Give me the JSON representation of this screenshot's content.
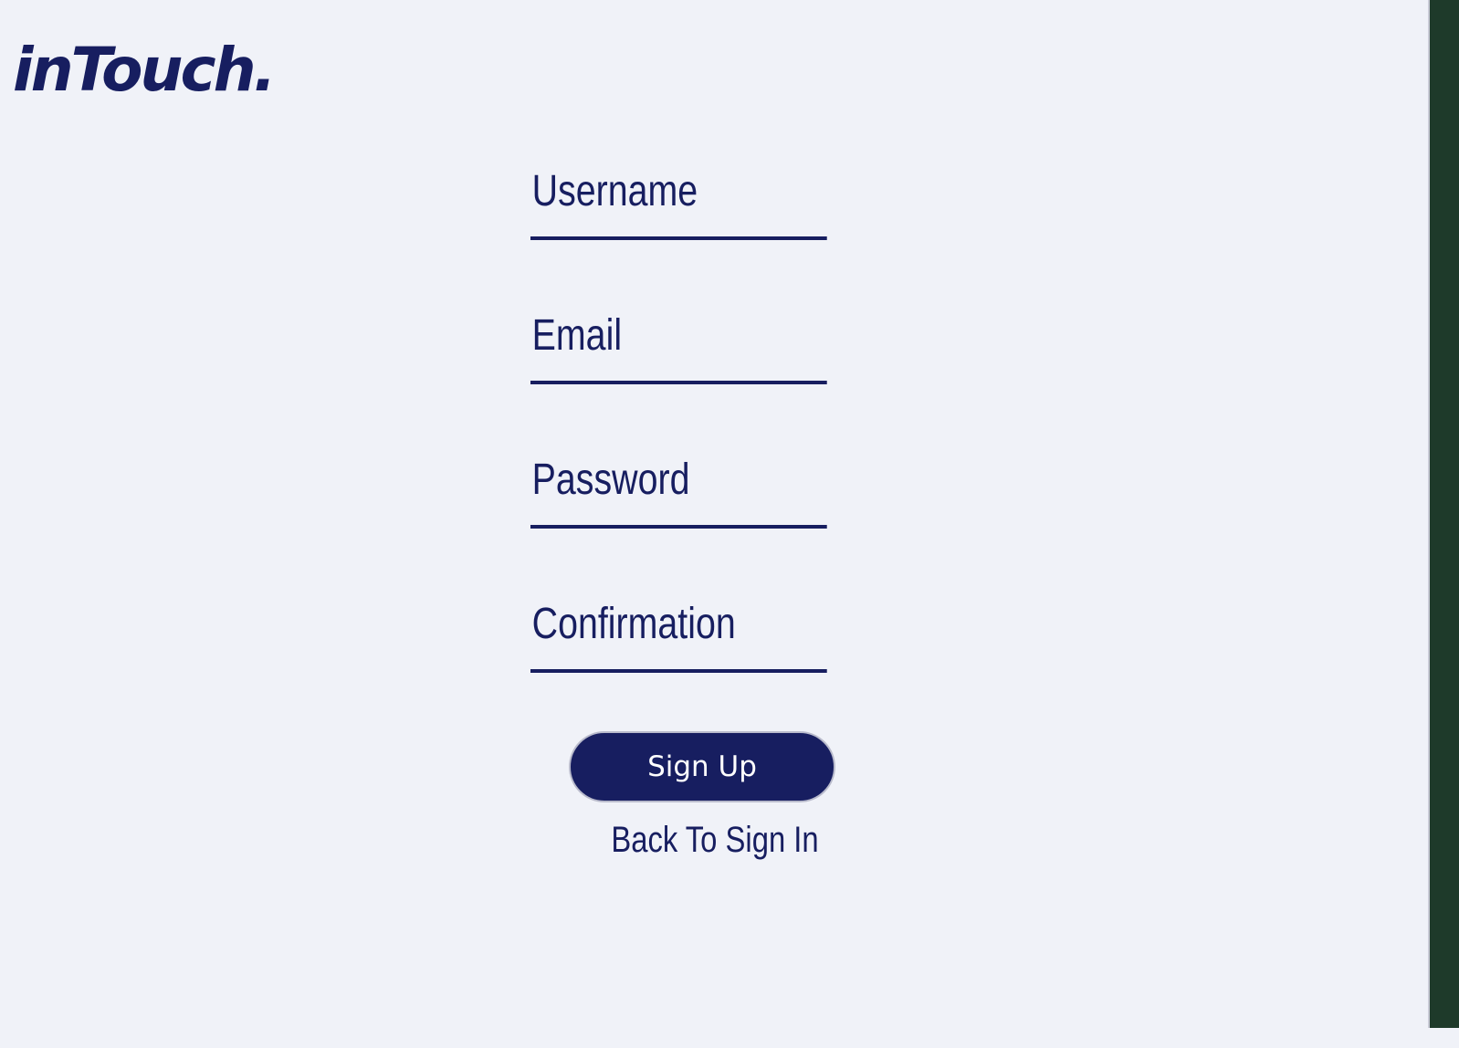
{
  "brand": {
    "logo_text": "inTouch."
  },
  "form": {
    "username_placeholder": "Username",
    "email_placeholder": "Email",
    "password_placeholder": "Password",
    "confirmation_placeholder": "Confirmation",
    "signup_label": "Sign Up",
    "back_label": "Back To Sign In"
  },
  "colors": {
    "primary": "#171e60",
    "background": "#f0f2f8",
    "button_text": "#ffffff"
  }
}
